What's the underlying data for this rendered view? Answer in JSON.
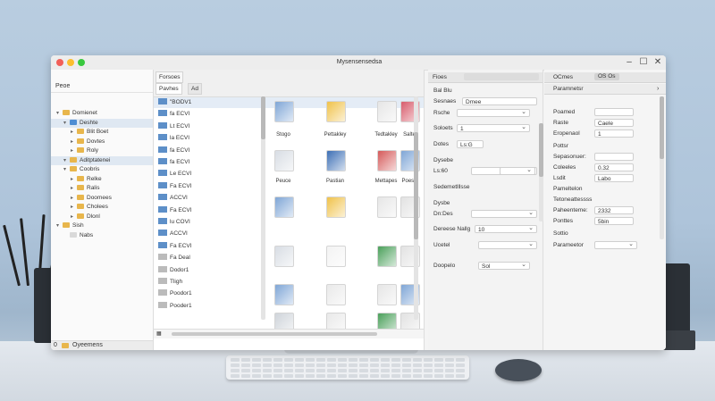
{
  "window": {
    "title": "Mysensensedsa",
    "close_glyph": "✕",
    "max_glyph": "☐",
    "min_glyph": "–",
    "traffic_colors": [
      "#f25f58",
      "#fbbe2e",
      "#3ac93f"
    ]
  },
  "tree": {
    "header": "Peoe",
    "items": [
      {
        "label": "Domienet",
        "arrow": "▾",
        "indent": 0,
        "color": "#e8b64c",
        "selected": false
      },
      {
        "label": "Deshte",
        "arrow": "▾",
        "indent": 1,
        "color": "#4f8ed3",
        "selected": true
      },
      {
        "label": "Blit Boet",
        "arrow": "▸",
        "indent": 2,
        "color": "#e8b64c",
        "selected": false
      },
      {
        "label": "Dovtes",
        "arrow": "▸",
        "indent": 2,
        "color": "#e8b64c",
        "selected": false
      },
      {
        "label": "Roly",
        "arrow": "▸",
        "indent": 2,
        "color": "#e8b64c",
        "selected": false
      },
      {
        "label": "Aditptatenei",
        "arrow": "▾",
        "indent": 1,
        "color": "#e8b64c",
        "selected": true
      },
      {
        "label": "Coobris",
        "arrow": "▾",
        "indent": 1,
        "color": "#e8b64c",
        "selected": false
      },
      {
        "label": "Relke",
        "arrow": "▸",
        "indent": 2,
        "color": "#e8b64c",
        "selected": false
      },
      {
        "label": "Ralis",
        "arrow": "▸",
        "indent": 2,
        "color": "#e8b64c",
        "selected": false
      },
      {
        "label": "Doomees",
        "arrow": "▸",
        "indent": 2,
        "color": "#e8b64c",
        "selected": false
      },
      {
        "label": "Cholees",
        "arrow": "▸",
        "indent": 2,
        "color": "#e8b64c",
        "selected": false
      },
      {
        "label": "Dlonl",
        "arrow": "▸",
        "indent": 2,
        "color": "#e8b64c",
        "selected": false
      },
      {
        "label": "Sish",
        "arrow": "▾",
        "indent": 0,
        "color": "#e8b64c",
        "selected": false
      },
      {
        "label": "Nabs",
        "arrow": "",
        "indent": 1,
        "color": "#d9d9d9",
        "selected": false
      }
    ],
    "status": "Oyeemens",
    "status_count": "0"
  },
  "list": {
    "tab_top": "Forsoes",
    "tabs": [
      "Pavhes",
      "Ad"
    ],
    "rows": [
      "\"BODV1",
      "fa ECVI",
      "Lt ECVI",
      "la ECVI",
      "fa ECVI",
      "fa ECVI",
      "Le ECVI",
      "Fa ECVI",
      "ACCVI",
      "Fa ECVI",
      "lu COVI",
      "ACCVI",
      "Fa ECVI",
      "Fa Deal",
      "Dodor1",
      "Tligh",
      "Poodor1",
      "Pooder1"
    ],
    "thumb_labels": [
      "Stogo",
      "Pettakley",
      "Tedtakley",
      "Salte",
      "Peuce",
      "Pastian",
      "Mettapes",
      "Poese"
    ]
  },
  "props": {
    "header": "Fioes",
    "section": "Bal Blu",
    "rows": [
      {
        "label": "Sesnaes",
        "value": "Dmee"
      },
      {
        "label": "Rsche",
        "value": ""
      },
      {
        "label": "Soloets",
        "value": "1"
      },
      {
        "label": "Dotes",
        "value": "Ls:G"
      },
      {
        "label": "Dysebe",
        "value": ""
      },
      {
        "label": "Ls:60",
        "value": ""
      },
      {
        "label": "Sedemetlllsse",
        "value": ""
      },
      {
        "label": "Dysbe",
        "value": ""
      },
      {
        "label": "Dn:Des",
        "value": ""
      },
      {
        "label": "Dereese Nallg",
        "value": "10"
      },
      {
        "label": "Ucetel",
        "value": ""
      },
      {
        "label": "Doopelo",
        "value": "Sol"
      }
    ]
  },
  "props2": {
    "tab": "OCmes",
    "tab2": "OS Os",
    "header": "Paramnetsr",
    "rows": [
      {
        "label": "Poamed",
        "value": ""
      },
      {
        "label": "Raste",
        "value": "Caele"
      },
      {
        "label": "Eropenaol",
        "value": "1"
      },
      {
        "label": "Pottsr",
        "value": ""
      },
      {
        "label": "Sepasonuer:",
        "value": ""
      },
      {
        "label": "Coleeles",
        "value": "0.32"
      },
      {
        "label": "Lsdit",
        "value": "Labo"
      },
      {
        "label": "Pameltelon",
        "value": ""
      },
      {
        "label": "Tetoneattessss",
        "value": ""
      },
      {
        "label": "Paheenteme:",
        "value": "2332"
      },
      {
        "label": "Ponttes",
        "value": "5bin"
      },
      {
        "label": "Sottio",
        "value": ""
      },
      {
        "label": "Parameetor",
        "value": ""
      }
    ]
  }
}
